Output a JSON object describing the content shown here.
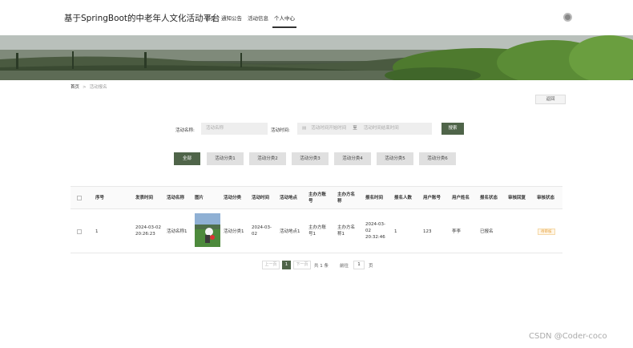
{
  "header": {
    "site_title": "基于SpringBoot的中老年人文化活动平台",
    "nav": [
      "首页",
      "通知公告",
      "活动信息",
      "个人中心"
    ]
  },
  "breadcrumb": {
    "home": "首页",
    "sep": ">",
    "current": "活动报名"
  },
  "back_label": "返回",
  "search": {
    "name_label": "活动名称:",
    "name_placeholder": "活动名称",
    "time_label": "活动时间:",
    "start_placeholder": "活动时间开始时间",
    "to": "至",
    "end_placeholder": "活动时间结束时间",
    "search_label": "搜索"
  },
  "categories": [
    "全部",
    "活动分类1",
    "活动分类2",
    "活动分类3",
    "活动分类4",
    "活动分类5",
    "活动分类6"
  ],
  "table": {
    "headers": [
      "序号",
      "发表时间",
      "活动名称",
      "图片",
      "活动分类",
      "活动时间",
      "活动地点",
      "主办方账号",
      "主办方名称",
      "报名时间",
      "报名人数",
      "用户账号",
      "用户姓名",
      "报名状态",
      "审核回复",
      "审核状态"
    ],
    "row": {
      "index": "1",
      "publish_time": "2024-03-02 20:26:23",
      "activity_name": "活动名称1",
      "category": "活动分类1",
      "activity_time": "2024-03-02",
      "location": "活动地点1",
      "host_account": "主办方账号1",
      "host_name": "主办方名称1",
      "signup_time": "2024-03-02 20:32:46",
      "signup_count": "1",
      "user_account": "123",
      "user_name": "李李",
      "signup_status": "已报名",
      "review_reply": "",
      "review_status": "待审核"
    }
  },
  "pagination": {
    "prev": "上一页",
    "page": "1",
    "next": "下一页",
    "total": "共 1 条",
    "goto": "前往",
    "goto_value": "1",
    "page_unit": "页"
  },
  "watermark": "CSDN @Coder-coco"
}
